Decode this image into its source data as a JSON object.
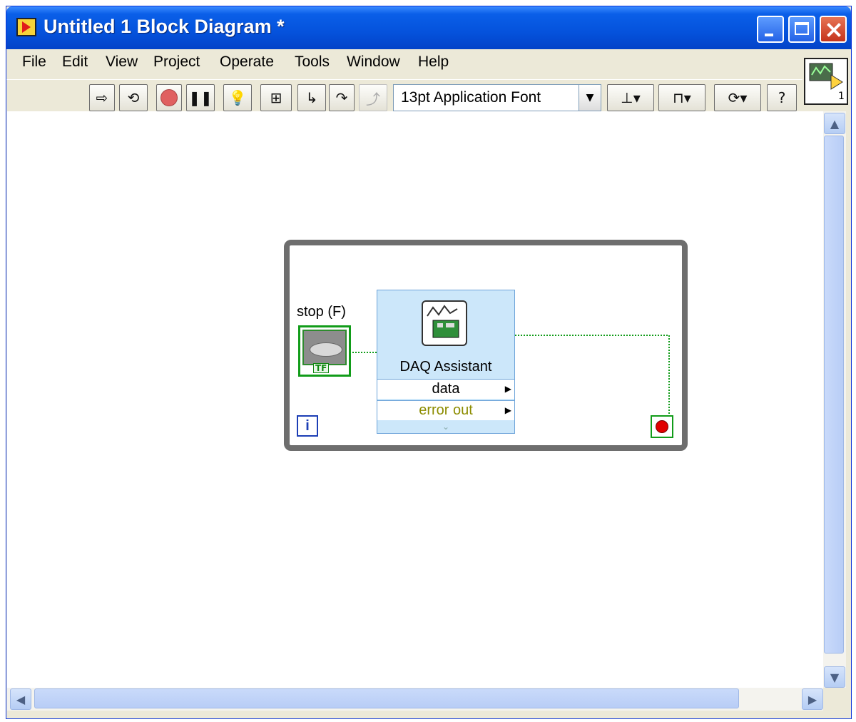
{
  "window": {
    "title": "Untitled 1 Block Diagram *",
    "icon": "labview-vi-icon",
    "controls": [
      "minimize-icon",
      "maximize-icon",
      "close-icon"
    ]
  },
  "menu": {
    "items": [
      "File",
      "Edit",
      "View",
      "Project",
      "Operate",
      "Tools",
      "Window",
      "Help"
    ]
  },
  "toolbar": {
    "buttons": [
      "run-arrow-icon",
      "run-continuously-icon",
      "abort-icon",
      "pause-icon",
      "highlight-execution-icon",
      "retain-wire-values-icon",
      "step-into-icon",
      "step-over-icon",
      "step-out-icon"
    ],
    "font_value": "13pt Application Font",
    "dropdowns": [
      "align-objects-icon",
      "distribute-objects-icon",
      "reorder-icon"
    ],
    "help_label": "?"
  },
  "connector_pane": {
    "number": "1",
    "icon": "vi-connector-pane-icon"
  },
  "diagram": {
    "stop_label": "stop (F)",
    "stop_bool_label": "TF",
    "daq_name": "DAQ Assistant",
    "daq_output_data": "data",
    "daq_output_error": "error out",
    "iteration_label": "i",
    "colors": {
      "loop_border": "#6e6e6e",
      "boolean_wire": "#119c19",
      "express_bg": "#cce7fa",
      "error_text": "#8c8c00"
    }
  }
}
